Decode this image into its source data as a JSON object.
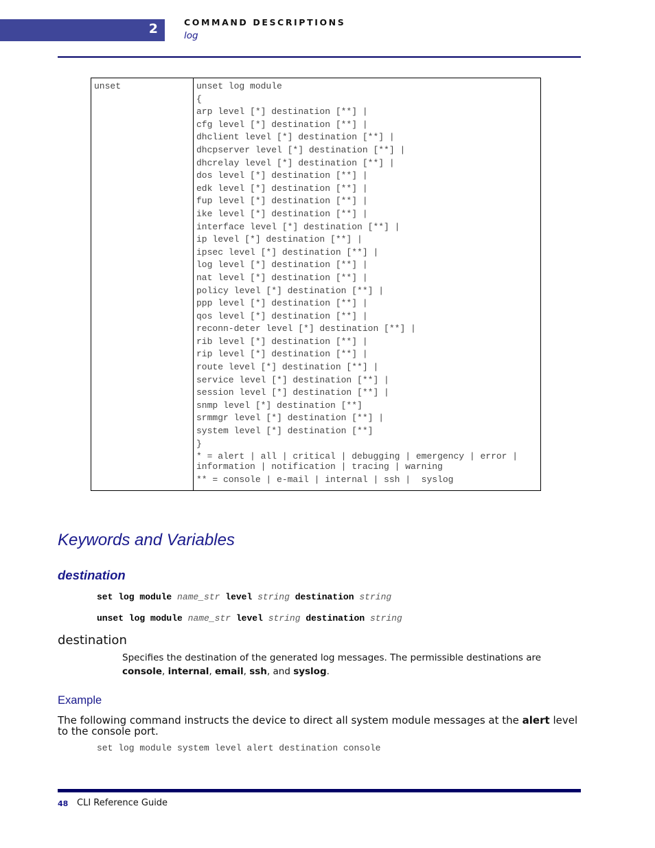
{
  "header": {
    "chapter_number": "2",
    "section_title": "COMMAND DESCRIPTIONS",
    "section_subtitle": "log",
    "accent_color": "#3f4699"
  },
  "syntax_table": {
    "command": "unset",
    "lines": [
      "unset log module",
      "{",
      "arp level [*] destination [**] |",
      "cfg level [*] destination [**] |",
      "dhclient level [*] destination [**] |",
      "dhcpserver level [*] destination [**] |",
      "dhcrelay level [*] destination [**] |",
      "dos level [*] destination [**] |",
      "edk level [*] destination [**] |",
      "fup level [*] destination [**] |",
      "ike level [*] destination [**] |",
      "interface level [*] destination [**] |",
      "ip level [*] destination [**] |",
      "ipsec level [*] destination [**] |",
      "log level [*] destination [**] |",
      "nat level [*] destination [**] |",
      "policy level [*] destination [**] |",
      "ppp level [*] destination [**] |",
      "qos level [*] destination [**] |",
      "reconn-deter level [*] destination [**] |",
      "rib level [*] destination [**] |",
      "rip level [*] destination [**] |",
      "route level [*] destination [**] |",
      "service level [*] destination [**] |",
      "session level [*] destination [**] |",
      "snmp level [*] destination [**]",
      "srmmgr level [*] destination [**] |",
      "system level [*] destination [**]",
      "}"
    ],
    "levels_note_line1": "* = alert | all | critical | debugging | emergency | error |",
    "levels_note_line2": "information | notification | tracing | warning",
    "destinations_note": "** = console | e-mail | internal | ssh |  syslog"
  },
  "keywords": {
    "heading": "Keywords and Variables",
    "subheading": "destination",
    "syntax": [
      {
        "cmd": "set log module",
        "v1": "name_str",
        "k2": "level",
        "v2": "string",
        "k3": "destination",
        "v3": "string"
      },
      {
        "cmd": "unset log module",
        "v1": "name_str",
        "k2": "level",
        "v2": "string",
        "k3": "destination",
        "v3": "string"
      }
    ],
    "term": "destination",
    "description_prefix": "Specifies the destination of the generated log messages. The permissible destinations are ",
    "destinations": [
      "console",
      "internal",
      "email",
      "ssh",
      "syslog"
    ],
    "sep_comma": ", ",
    "sep_and": ", and ",
    "description_suffix": "."
  },
  "example": {
    "heading": "Example",
    "text_prefix": "The following command instructs the device to direct all system module messages at the ",
    "text_bold": "alert",
    "text_suffix": " level to the console port.",
    "code": "set log module system level alert destination console"
  },
  "footer": {
    "page_number": "48",
    "guide_name": "CLI Reference Guide"
  }
}
